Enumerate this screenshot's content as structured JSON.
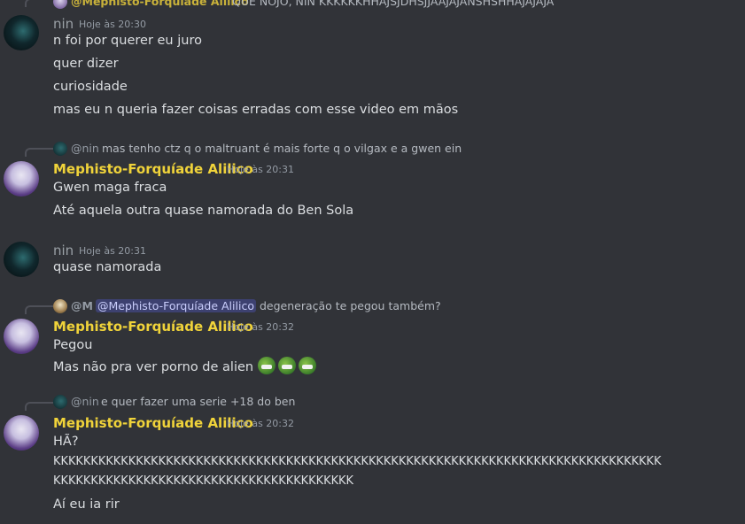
{
  "top_reply": {
    "name": "@Mephisto-Forquíade Alilico",
    "text": "QUE NOJO, NIN KKKKKKHHAJSJDHSJJAAJAJANSHSHHAJAJAJA"
  },
  "groups": [
    {
      "author": "nin",
      "timestamp": "Hoje às 20:30",
      "lines": [
        "n foi por querer eu juro",
        "quer dizer",
        "curiosidade",
        "mas eu n queria fazer coisas erradas com esse video em mãos"
      ]
    },
    {
      "reply": {
        "name": "@nin",
        "text": "mas tenho ctz q o maltruant é mais forte q o vilgax e a gwen ein"
      },
      "author": "Mephisto-Forquíade Alilico",
      "timestamp": "Hoje às 20:31",
      "lines": [
        "Gwen maga fraca",
        "Até aquela outra quase namorada do Ben Sola"
      ]
    },
    {
      "author": "nin",
      "timestamp": "Hoje às 20:31",
      "lines": [
        "quase namorada"
      ]
    },
    {
      "reply": {
        "name": "@M",
        "mention": "@Mephisto-Forquíade Alilico",
        "text": "degeneração te pegou também?"
      },
      "author": "Mephisto-Forquíade Alilico",
      "timestamp": "Hoje às 20:32",
      "lines": [
        "Pegou",
        "Mas não pra ver porno de alien"
      ],
      "emojis": [
        "grimacing-frog-emoji",
        "grimacing-frog-emoji",
        "grimacing-frog-emoji"
      ]
    },
    {
      "reply": {
        "name": "@nin",
        "text": "e quer fazer uma serie +18 do ben"
      },
      "author": "Mephisto-Forquíade Alilico",
      "timestamp": "Hoje às 20:32",
      "lines": [
        "HÃ?",
        "KKKKKKKKKKKKKKKKKKKKKKKKKKKKKKKKKKKKKKKKKKKKKKKKKKKKKKKKKKKKKKKKKKKKKKKKKKKKKKKKK",
        "KKKKKKKKKKKKKKKKKKKKKKKKKKKKKKKKKKKKKKKK",
        "Aí eu ia rir"
      ]
    }
  ],
  "colors": {
    "background": "#313338",
    "text": "#dbdee1",
    "meph_name": "#f0d33a",
    "nin_name": "#9aa0a6",
    "timestamp": "#949ba4",
    "mention_bg": "#3c4270"
  }
}
